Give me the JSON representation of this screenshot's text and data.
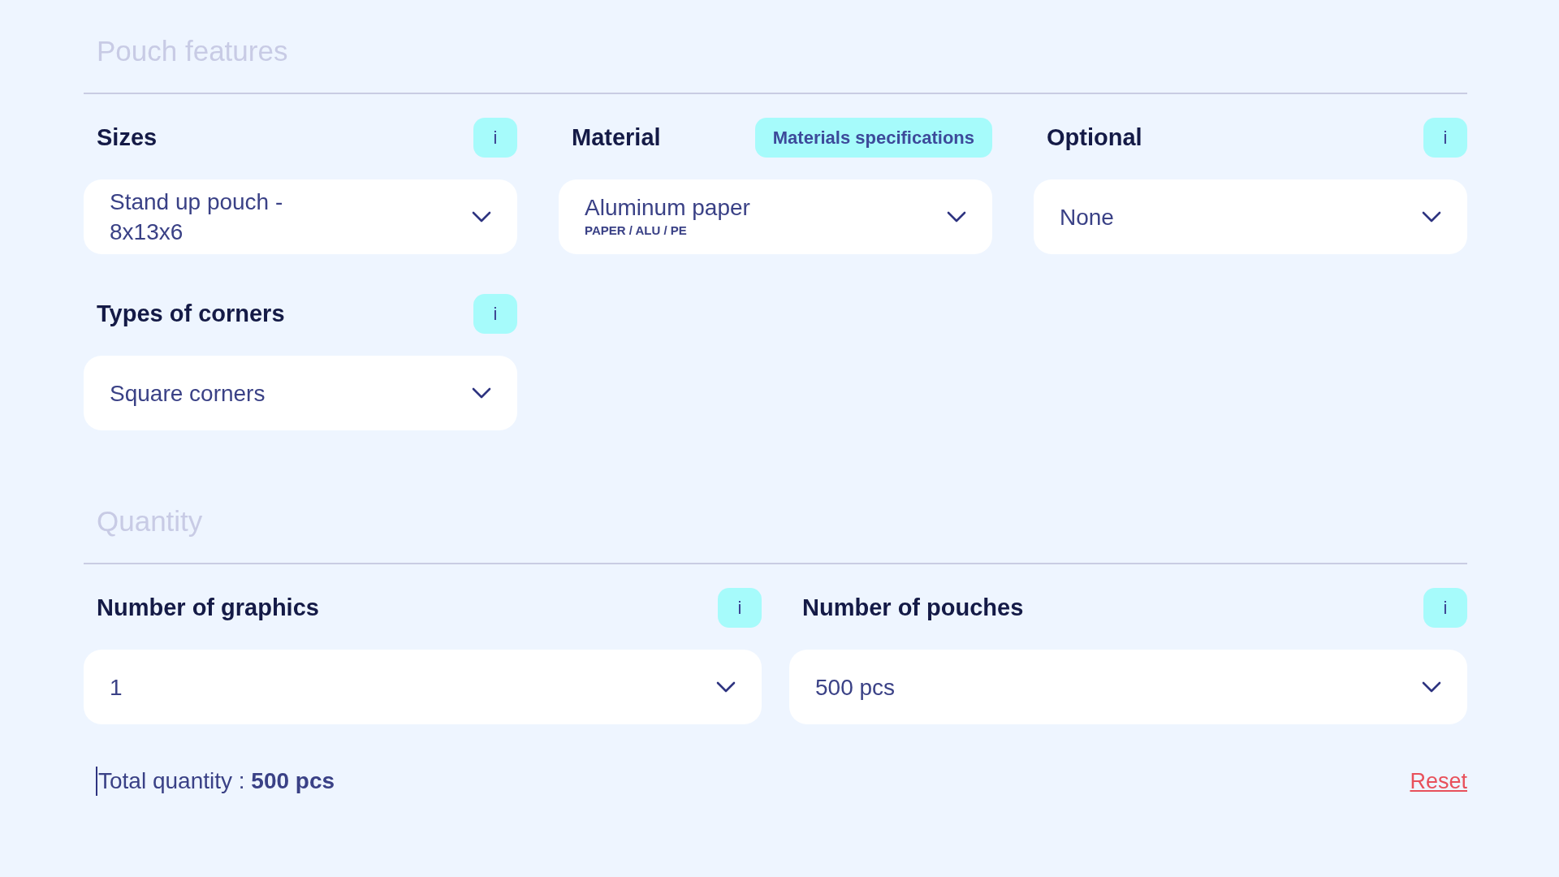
{
  "sections": [
    {
      "title": "Pouch features",
      "fields": [
        {
          "label": "Sizes",
          "action": {
            "kind": "info",
            "text": "i"
          },
          "value": "Stand up pouch - 8x13x6"
        },
        {
          "label": "Material",
          "action": {
            "kind": "text",
            "text": "Materials specifications"
          },
          "value": "Aluminum paper",
          "detail": "PAPER / ALU / PE"
        },
        {
          "label": "Optional",
          "action": {
            "kind": "info",
            "text": "i"
          },
          "value": "None"
        },
        {
          "label": "Types of corners",
          "action": {
            "kind": "info",
            "text": "i"
          },
          "value": "Square corners"
        }
      ]
    },
    {
      "title": "Quantity",
      "fields": [
        {
          "label": "Number of graphics",
          "action": {
            "kind": "info",
            "text": "i"
          },
          "value": "1"
        },
        {
          "label": "Number of pouches",
          "action": {
            "kind": "info",
            "text": "i"
          },
          "value": "500 pcs"
        }
      ]
    }
  ],
  "summary": "Total quantity : **500 pcs**",
  "reset": "Reset"
}
